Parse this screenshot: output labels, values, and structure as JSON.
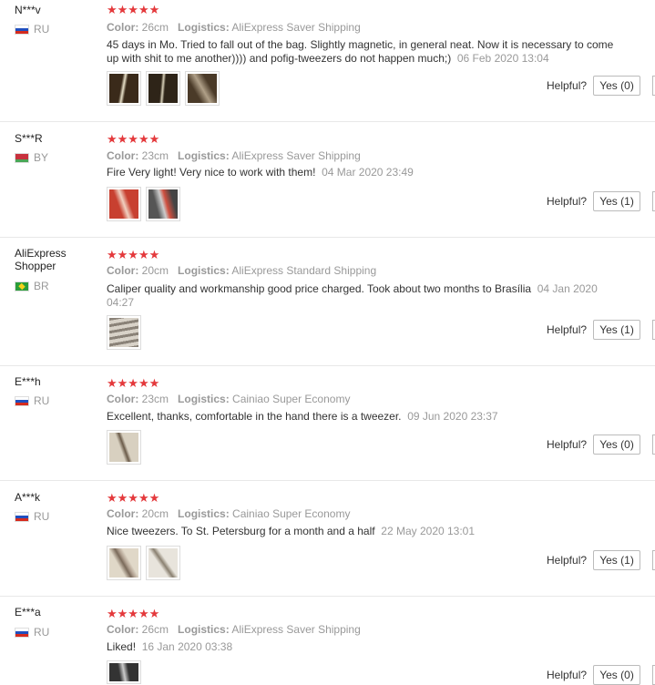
{
  "labels": {
    "color": "Color:",
    "logistics": "Logistics:",
    "helpful": "Helpful?"
  },
  "stars": "★★★★★",
  "reviews": [
    {
      "user": "N***v",
      "country": "RU",
      "flag": "ru",
      "color": "26cm",
      "logistics": "AliExpress Saver Shipping",
      "text": "45 days in Mo. Tried to fall out of the bag. Slightly magnetic, in general neat. Now it is necessary to come up with shit to me another)))) and pofig-tweezers do not happen much;)",
      "date": "06 Feb 2020 13:04",
      "yes": "Yes (0)"
    },
    {
      "user": "S***R",
      "country": "BY",
      "flag": "by",
      "color": "23cm",
      "logistics": "AliExpress Saver Shipping",
      "text": "Fire Very light! Very nice to work with them!",
      "date": "04 Mar 2020 23:49",
      "yes": "Yes (1)"
    },
    {
      "user": "AliExpress Shopper",
      "country": "BR",
      "flag": "br",
      "color": "20cm",
      "logistics": "AliExpress Standard Shipping",
      "text": "Caliper quality and workmanship good price charged. Took about two months to Brasília",
      "date": "04 Jan 2020 04:27",
      "yes": "Yes (1)"
    },
    {
      "user": "E***h",
      "country": "RU",
      "flag": "ru",
      "color": "23cm",
      "logistics": "Cainiao Super Economy",
      "text": "Excellent, thanks, comfortable in the hand there is a tweezer.",
      "date": "09 Jun 2020 23:37",
      "yes": "Yes (0)"
    },
    {
      "user": "A***k",
      "country": "RU",
      "flag": "ru",
      "color": "20cm",
      "logistics": "Cainiao Super Economy",
      "text": "Nice tweezers. To St. Petersburg for a month and a half",
      "date": "22 May 2020 13:01",
      "yes": "Yes (1)"
    },
    {
      "user": "E***a",
      "country": "RU",
      "flag": "ru",
      "color": "26cm",
      "logistics": "AliExpress Saver Shipping",
      "text": "Liked!",
      "date": "16 Jan 2020 03:38",
      "yes": "Yes (0)"
    }
  ]
}
